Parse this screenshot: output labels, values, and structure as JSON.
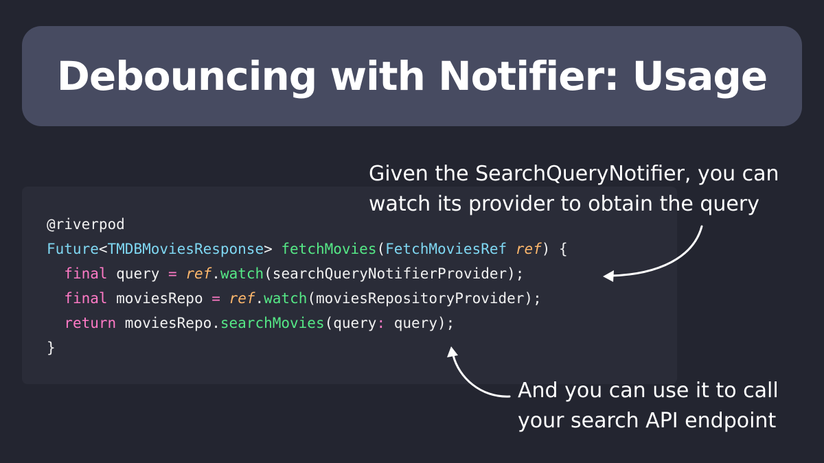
{
  "title": "Debouncing with Notifier: Usage",
  "code": {
    "language": "dart",
    "lines": [
      [
        {
          "text": "@riverpod",
          "kind": "annotation"
        }
      ],
      [
        {
          "text": "Future",
          "kind": "type"
        },
        {
          "text": "<",
          "kind": "plain"
        },
        {
          "text": "TMDBMoviesResponse",
          "kind": "type"
        },
        {
          "text": "> ",
          "kind": "plain"
        },
        {
          "text": "fetchMovies",
          "kind": "func"
        },
        {
          "text": "(",
          "kind": "plain"
        },
        {
          "text": "FetchMoviesRef",
          "kind": "type"
        },
        {
          "text": " ",
          "kind": "plain"
        },
        {
          "text": "ref",
          "kind": "param"
        },
        {
          "text": ") {",
          "kind": "plain"
        }
      ],
      [
        {
          "text": "  ",
          "kind": "plain"
        },
        {
          "text": "final",
          "kind": "keyword"
        },
        {
          "text": " query ",
          "kind": "plain"
        },
        {
          "text": "=",
          "kind": "keyword"
        },
        {
          "text": " ",
          "kind": "plain"
        },
        {
          "text": "ref",
          "kind": "param"
        },
        {
          "text": ".",
          "kind": "plain"
        },
        {
          "text": "watch",
          "kind": "func"
        },
        {
          "text": "(searchQueryNotifierProvider);",
          "kind": "plain"
        }
      ],
      [
        {
          "text": "  ",
          "kind": "plain"
        },
        {
          "text": "final",
          "kind": "keyword"
        },
        {
          "text": " moviesRepo ",
          "kind": "plain"
        },
        {
          "text": "=",
          "kind": "keyword"
        },
        {
          "text": " ",
          "kind": "plain"
        },
        {
          "text": "ref",
          "kind": "param"
        },
        {
          "text": ".",
          "kind": "plain"
        },
        {
          "text": "watch",
          "kind": "func"
        },
        {
          "text": "(moviesRepositoryProvider);",
          "kind": "plain"
        }
      ],
      [
        {
          "text": "  ",
          "kind": "plain"
        },
        {
          "text": "return",
          "kind": "keyword"
        },
        {
          "text": " moviesRepo.",
          "kind": "plain"
        },
        {
          "text": "searchMovies",
          "kind": "func"
        },
        {
          "text": "(query",
          "kind": "plain"
        },
        {
          "text": ":",
          "kind": "keyword"
        },
        {
          "text": " query);",
          "kind": "plain"
        }
      ],
      [
        {
          "text": "}",
          "kind": "plain"
        }
      ]
    ]
  },
  "callouts": {
    "top": {
      "line1": "Given the SearchQueryNotifier, you can",
      "line2": "watch its provider to obtain the query"
    },
    "bottom": {
      "line1": "And you can use it to call",
      "line2": "your search API endpoint"
    }
  },
  "colors": {
    "background": "#232530",
    "title_banner": "#474b61",
    "code_panel": "#2a2c38",
    "text": "#ffffff",
    "type": "#7fd7f2",
    "function": "#55e886",
    "keyword": "#ff7ac6",
    "parameter": "#ffb86c"
  }
}
